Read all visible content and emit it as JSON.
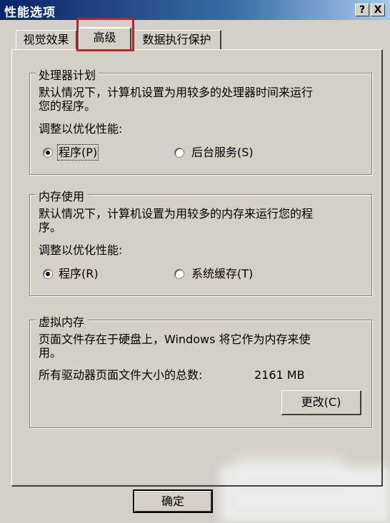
{
  "window": {
    "title": "性能选项",
    "help_btn": "?",
    "close_btn": "X"
  },
  "tabs": [
    {
      "label": "视觉效果"
    },
    {
      "label": "高级"
    },
    {
      "label": "数据执行保护"
    }
  ],
  "processor": {
    "title": "处理器计划",
    "desc_line1": "默认情况下，计算机设置为用较多的处理器时间来运行",
    "desc_line2": "您的程序。",
    "adjust_label": "调整以优化性能:",
    "option_programs": "程序(P)",
    "option_background": "后台服务(S)",
    "selected": "程序(P)"
  },
  "memory": {
    "title": "内存使用",
    "desc_line1": "默认情况下，计算机设置为用较多的内存来运行您的程",
    "desc_line2": "序。",
    "adjust_label": "调整以优化性能:",
    "option_programs": "程序(R)",
    "option_cache": "系统缓存(T)",
    "selected": "程序(R)"
  },
  "virtual": {
    "title": "虚拟内存",
    "desc_line1": "页面文件存在于硬盘上，Windows 将它作为内存来使",
    "desc_line2": "用。",
    "total_label": "所有驱动器页面文件大小的总数:",
    "total_value": "2161 MB",
    "change_button": "更改(C)"
  },
  "footer": {
    "ok_button": "确定"
  }
}
